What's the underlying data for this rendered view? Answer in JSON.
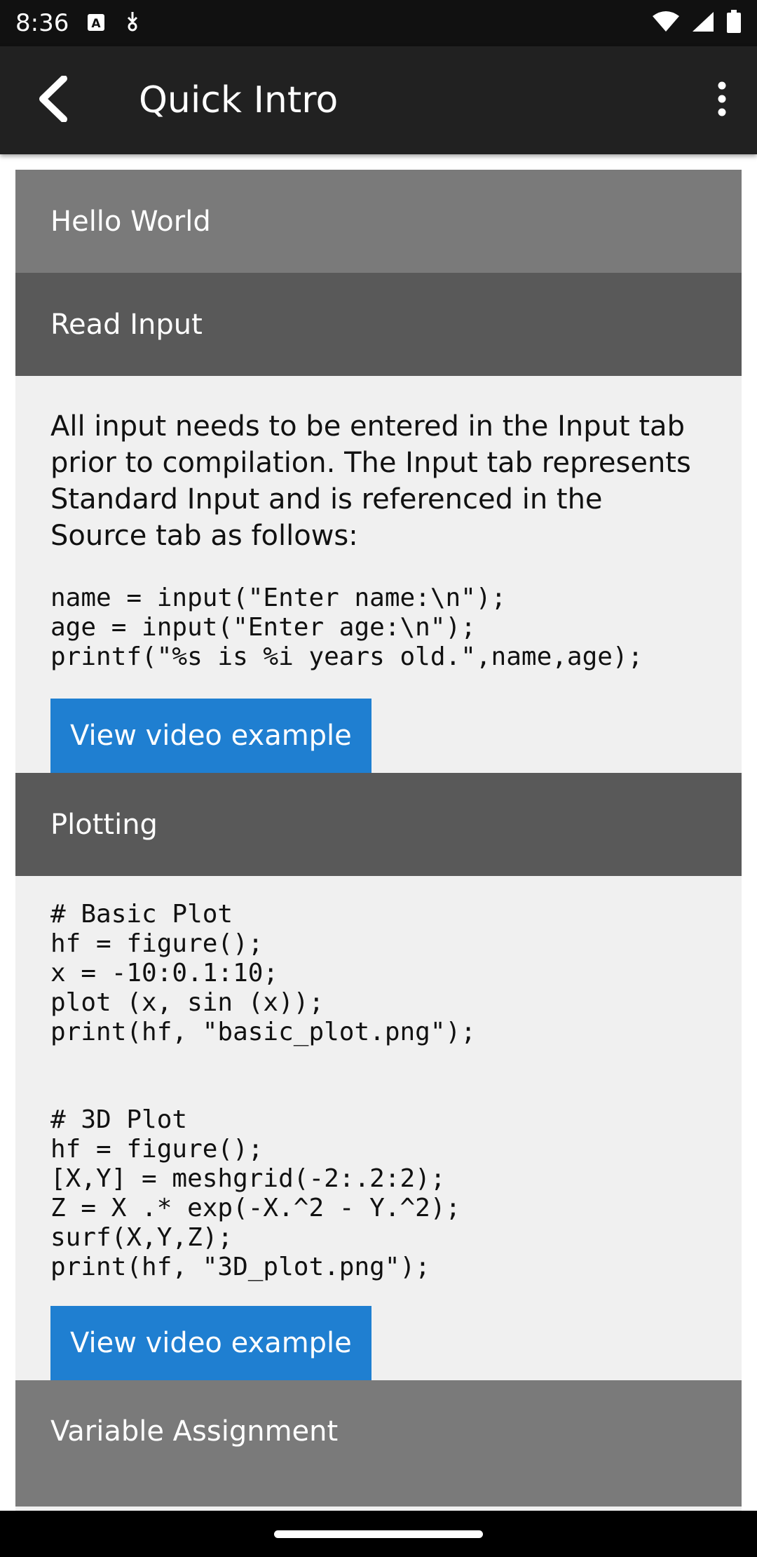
{
  "status_bar": {
    "time": "8:36",
    "icons": [
      "text-a-icon",
      "download-icon",
      "wifi-icon",
      "signal-icon",
      "battery-icon"
    ]
  },
  "app_bar": {
    "title": "Quick Intro",
    "back_icon": "chevron-left-icon",
    "menu_icon": "more-vertical-icon"
  },
  "sections": {
    "hello_world": {
      "title": "Hello World"
    },
    "read_input": {
      "title": "Read Input",
      "description": "All input needs to be entered in the Input tab prior to compilation. The Input tab represents Standard Input and is referenced in the Source tab as follows:",
      "code": "name = input(\"Enter name:\\n\");\nage = input(\"Enter age:\\n\");\nprintf(\"%s is %i years old.\",name,age);",
      "button_label": "View video example"
    },
    "plotting": {
      "title": "Plotting",
      "code_basic": "# Basic Plot\nhf = figure();\nx = -10:0.1:10;\nplot (x, sin (x));\nprint(hf, \"basic_plot.png\");",
      "code_3d": "# 3D Plot\nhf = figure();\n[X,Y] = meshgrid(-2:.2:2);\nZ = X .* exp(-X.^2 - Y.^2);\nsurf(X,Y,Z);\nprint(hf, \"3D_plot.png\");",
      "button_label": "View video example"
    },
    "variable_assignment": {
      "title": "Variable Assignment"
    }
  },
  "colors": {
    "app_bar": "#212121",
    "status_bar": "#111111",
    "header_collapsed": "#7a7a7a",
    "header_expanded": "#595959",
    "body_bg": "#f0f0f0",
    "button": "#1f7fd1"
  }
}
